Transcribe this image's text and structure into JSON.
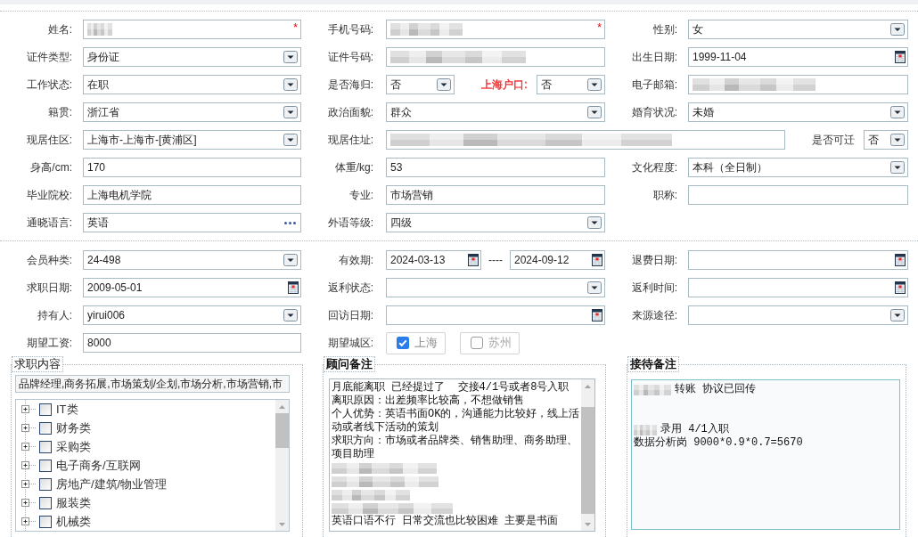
{
  "basic_info": {
    "rows": [
      {
        "groups": [
          [
            {
              "label": "姓名:",
              "kind": "text",
              "blurred": true,
              "required_mark": "*"
            }
          ],
          [
            {
              "label": "手机号码:",
              "kind": "text",
              "blurred": true,
              "required_mark": "*"
            }
          ],
          [
            {
              "label": "性别:",
              "kind": "select",
              "value": "女",
              "blurred": false
            }
          ]
        ]
      },
      {
        "groups": [
          [
            {
              "label": "证件类型:",
              "kind": "select",
              "value": "身份证",
              "blurred": false
            }
          ],
          [
            {
              "label": "证件号码:",
              "kind": "text",
              "blurred": true
            }
          ],
          [
            {
              "label": "出生日期:",
              "kind": "date",
              "value": "1999-11-04",
              "blurred": false
            }
          ]
        ]
      },
      {
        "groups": [
          [
            {
              "label": "工作状态:",
              "kind": "select",
              "value": "在职",
              "blurred": false
            }
          ],
          [
            {
              "label": "是否海归:",
              "kind": "select",
              "value": "否",
              "blurred": false
            },
            {
              "label": "上海户口:",
              "kind": "select",
              "value": "否",
              "blurred": false,
              "color": "#f02b2b"
            }
          ],
          [
            {
              "label": "电子邮箱:",
              "kind": "text",
              "blurred": true
            }
          ]
        ]
      },
      {
        "groups": [
          [
            {
              "label": "籍贯:",
              "kind": "select",
              "value": "浙江省",
              "blurred": false
            }
          ],
          [
            {
              "label": "政治面貌:",
              "kind": "select",
              "value": "群众",
              "blurred": false
            }
          ],
          [
            {
              "label": "婚育状况:",
              "kind": "select",
              "value": "未婚",
              "blurred": false
            }
          ]
        ]
      },
      {
        "groups": [
          [
            {
              "label": "现居住区:",
              "kind": "select",
              "value": "上海市-上海市-[黄浦区]",
              "blurred": false
            }
          ],
          [
            {
              "label": "现居住址:",
              "kind": "text",
              "blurred": true
            },
            {
              "label": "是否可迁",
              "kind": "select",
              "value": "否",
              "blurred": false
            }
          ]
        ]
      },
      {
        "groups": [
          [
            {
              "label": "身高/cm:",
              "kind": "text",
              "value": "170",
              "blurred": false
            }
          ],
          [
            {
              "label": "体重/kg:",
              "kind": "text",
              "value": "53",
              "blurred": false
            }
          ],
          [
            {
              "label": "文化程度:",
              "kind": "select",
              "value": "本科（全日制）",
              "blurred": false
            }
          ]
        ]
      },
      {
        "groups": [
          [
            {
              "label": "毕业院校:",
              "kind": "text",
              "value": "上海电机学院",
              "blurred": false
            }
          ],
          [
            {
              "label": "专业:",
              "kind": "text",
              "value": "市场营销",
              "blurred": false
            }
          ],
          [
            {
              "label": "职称:",
              "kind": "text",
              "blurred": false
            }
          ]
        ]
      },
      {
        "groups": [
          [
            {
              "label": "通晓语言:",
              "kind": "lookup",
              "value": "英语",
              "blurred": false
            }
          ],
          [
            {
              "label": "外语等级:",
              "kind": "select",
              "value": "四级",
              "blurred": false
            }
          ]
        ]
      }
    ]
  },
  "membership": {
    "rows": [
      {
        "groups": [
          [
            {
              "label": "会员种类:",
              "kind": "select",
              "value": "24-498"
            }
          ],
          [
            {
              "label": "有效期:",
              "kind": "date_range",
              "values": [
                "2024-03-13",
                "2024-09-12"
              ],
              "separator": "----"
            }
          ],
          [
            {
              "label": "退费日期:",
              "kind": "date"
            }
          ]
        ]
      },
      {
        "groups": [
          [
            {
              "label": "求职日期:",
              "kind": "date",
              "value": "2009-05-01"
            }
          ],
          [
            {
              "label": "返利状态:",
              "kind": "select"
            }
          ],
          [
            {
              "label": "返利时间:",
              "kind": "date"
            }
          ]
        ]
      },
      {
        "groups": [
          [
            {
              "label": "持有人:",
              "kind": "select",
              "value": "yirui006"
            }
          ],
          [
            {
              "label": "回访日期:",
              "kind": "date"
            }
          ],
          [
            {
              "label": "来源途径:",
              "kind": "select"
            }
          ]
        ]
      },
      {
        "groups": [
          [
            {
              "label": "期望工资:",
              "kind": "text",
              "value": "8000"
            }
          ],
          [
            {
              "label": "期望城区:",
              "kind": "checkbox_group",
              "options": [
                {
                  "label": "上海",
                  "checked": true
                },
                {
                  "label": "苏州",
                  "checked": false
                }
              ]
            }
          ]
        ]
      }
    ]
  },
  "panels": [
    {
      "title": "求职内容",
      "bold_title": false,
      "kind": "job_picker",
      "scrollable": true,
      "selection": "品牌经理,商务拓展,市场策划/企划,市场分析,市场营销,市",
      "tree": [
        {
          "label": "IT类",
          "expanded": false,
          "checked": false
        },
        {
          "label": "财务类",
          "expanded": false,
          "checked": false
        },
        {
          "label": "采购类",
          "expanded": false,
          "checked": false
        },
        {
          "label": "电子商务/互联网",
          "expanded": false,
          "checked": false
        },
        {
          "label": "房地产/建筑/物业管理",
          "expanded": false,
          "checked": false
        },
        {
          "label": "服装类",
          "expanded": false,
          "checked": false
        },
        {
          "label": "机械类",
          "expanded": false,
          "checked": false
        }
      ]
    },
    {
      "title": "顾问备注",
      "bold_title": true,
      "kind": "notes",
      "focused": false,
      "scrollable": true,
      "lines": [
        {
          "kind": "text",
          "text": "月底能离职 已经提过了  交接4/1号或者8号入职"
        },
        {
          "kind": "text",
          "text": "离职原因：出差频率比较高，不想做销售"
        },
        {
          "kind": "text",
          "text": "个人优势：英语书面OK的，沟通能力比较好，线上活"
        },
        {
          "kind": "text",
          "text": "动或者线下活动的策划"
        },
        {
          "kind": "text",
          "text": "求职方向：市场或者品牌类、销售助理、商务助理、"
        },
        {
          "kind": "text",
          "text": "项目助理"
        },
        {
          "kind": "blurred"
        },
        {
          "kind": "blurred"
        },
        {
          "kind": "blurred"
        },
        {
          "kind": "blurred"
        },
        {
          "kind": "text",
          "text": "英语口语不行 日常交流也比较困难 主要是书面"
        }
      ]
    },
    {
      "title": "接待备注",
      "bold_title": true,
      "kind": "notes",
      "focused": true,
      "scrollable": false,
      "lines": [
        {
          "kind": "blurred_prefix",
          "text": "转账 协议已回传"
        },
        {
          "kind": "blank"
        },
        {
          "kind": "blank"
        },
        {
          "kind": "blurred_prefix",
          "text": "录用 4/1入职"
        },
        {
          "kind": "text",
          "text": "数据分析岗 9000*0.9*0.7=5670"
        }
      ]
    }
  ]
}
